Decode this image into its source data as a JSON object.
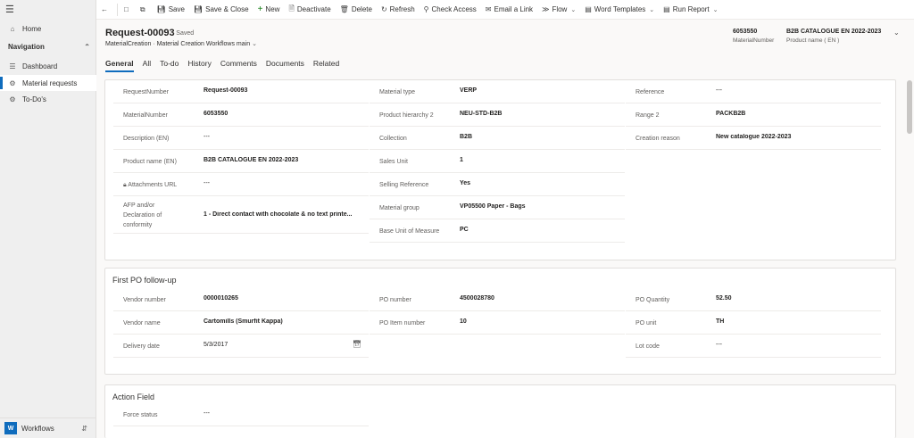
{
  "sidebar": {
    "home": "Home",
    "nav_heading": "Navigation",
    "items": [
      {
        "label": "Dashboard"
      },
      {
        "label": "Material requests"
      },
      {
        "label": "To-Do's"
      }
    ],
    "area": {
      "badge": "W",
      "label": "Workflows"
    }
  },
  "commands": {
    "save": "Save",
    "save_close": "Save & Close",
    "new": "New",
    "deactivate": "Deactivate",
    "delete": "Delete",
    "refresh": "Refresh",
    "check_access": "Check Access",
    "email_link": "Email a Link",
    "flow": "Flow",
    "word_templates": "Word Templates",
    "run_report": "Run Report"
  },
  "header": {
    "title": "Request-00093",
    "status": "- Saved",
    "entity": "MaterialCreation",
    "form": "Material Creation Workflows main",
    "fields": [
      {
        "value": "6053550",
        "label": "MaterialNumber"
      },
      {
        "value": "B2B CATALOGUE EN 2022-2023",
        "label": "Product name ( EN )"
      }
    ]
  },
  "tabs": [
    "General",
    "All",
    "To-do",
    "History",
    "Comments",
    "Documents",
    "Related"
  ],
  "general": {
    "col1": [
      {
        "label": "RequestNumber",
        "value": "Request-00093"
      },
      {
        "label": "MaterialNumber",
        "value": "6053550"
      },
      {
        "label": "Description (EN)",
        "value": "---"
      },
      {
        "label": "Product name (EN)",
        "value": "B2B CATALOGUE EN 2022-2023"
      },
      {
        "label": "Attachments URL",
        "value": "---"
      },
      {
        "label": "AFP and/or Declaration of conformity",
        "value": "1 - Direct contact with chocolate & no text printe..."
      }
    ],
    "col2": [
      {
        "label": "Material type",
        "value": "VERP"
      },
      {
        "label": "Product hierarchy 2",
        "value": "NEU-STD-B2B"
      },
      {
        "label": "Collection",
        "value": "B2B"
      },
      {
        "label": "Sales Unit",
        "value": "1"
      },
      {
        "label": "Selling Reference",
        "value": "Yes"
      },
      {
        "label": "Material group",
        "value": "VP05500 Paper - Bags"
      },
      {
        "label": "Base Unit of Measure",
        "value": "PC"
      }
    ],
    "col3": [
      {
        "label": "Reference",
        "value": "---"
      },
      {
        "label": "Range 2",
        "value": "PACKB2B"
      },
      {
        "label": "Creation reason",
        "value": "New catalogue 2022-2023"
      }
    ]
  },
  "po": {
    "title": "First PO follow-up",
    "col1": [
      {
        "label": "Vendor number",
        "value": "0000010265"
      },
      {
        "label": "Vendor name",
        "value": "Cartomills (Smurfit Kappa)"
      },
      {
        "label": "Delivery date",
        "value": "5/3/2017"
      }
    ],
    "col2": [
      {
        "label": "PO number",
        "value": "4500028780"
      },
      {
        "label": "PO Item number",
        "value": "10"
      }
    ],
    "col3": [
      {
        "label": "PO Quantity",
        "value": "52.50"
      },
      {
        "label": "PO unit",
        "value": "TH"
      },
      {
        "label": "Lot code",
        "value": "---"
      }
    ]
  },
  "action": {
    "title": "Action Field",
    "fields": [
      {
        "label": "Force status",
        "value": "---"
      }
    ]
  },
  "colors": {
    "accent": "#0f6cbd",
    "background": "#faf9f8"
  }
}
